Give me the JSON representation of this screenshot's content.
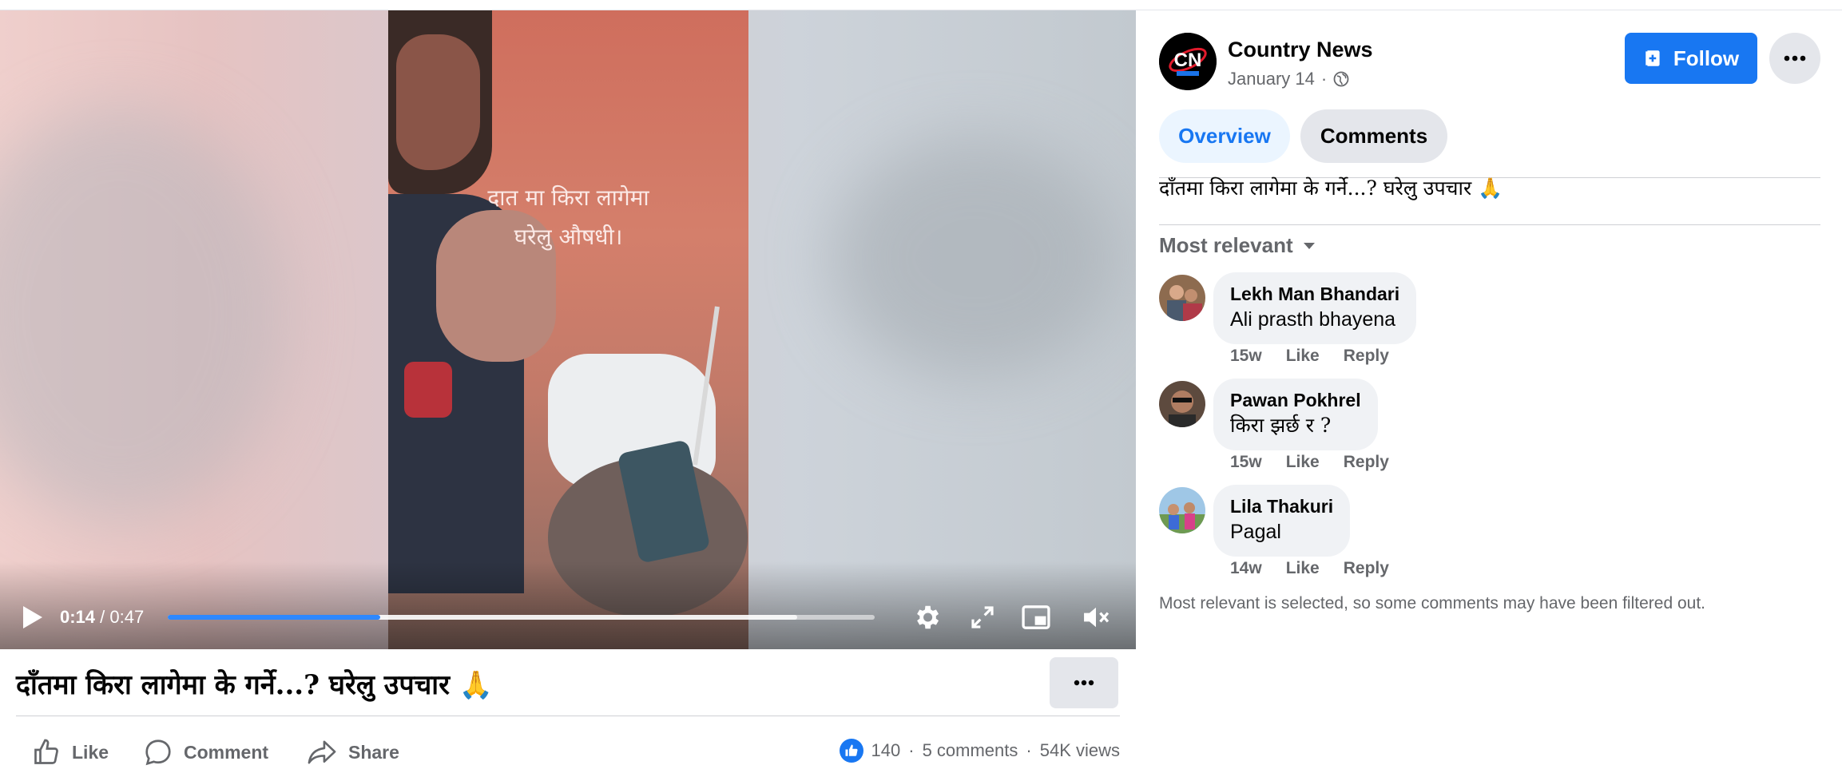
{
  "video": {
    "overlay_line1": "दात मा किरा लागेमा",
    "overlay_line2": "घरेलु औषधी।",
    "current_time": "0:14",
    "separator": "/",
    "duration": "0:47",
    "progress_fraction": 0.3,
    "buffered_fraction": 0.89
  },
  "post": {
    "title": "दाँतमा किरा लागेमा के गर्ने...? घरेलु उपचार 🙏",
    "actions": {
      "like": "Like",
      "comment": "Comment",
      "share": "Share"
    },
    "stats": {
      "reactions": "140",
      "dot1": "·",
      "comments": "5 comments",
      "dot2": "·",
      "views": "54K views"
    }
  },
  "page": {
    "name": "Country News",
    "date": "January 14",
    "meta_dot": "·",
    "avatar_text": "CN",
    "follow_label": "Follow"
  },
  "tabs": {
    "overview": "Overview",
    "comments": "Comments"
  },
  "caption": "दाँतमा किरा लागेमा के गर्ने...? घरेलु उपचार 🙏",
  "sort": {
    "label": "Most relevant"
  },
  "comments": [
    {
      "name": "Lekh Man Bhandari",
      "text": "Ali prasth bhayena",
      "time": "15w",
      "like": "Like",
      "reply": "Reply"
    },
    {
      "name": "Pawan Pokhrel",
      "text": "किरा झर्छ र ?",
      "time": "15w",
      "like": "Like",
      "reply": "Reply"
    },
    {
      "name": "Lila Thakuri",
      "text": "Pagal",
      "time": "14w",
      "like": "Like",
      "reply": "Reply"
    }
  ],
  "filter_note": "Most relevant is selected, so some comments may have been filtered out.",
  "colors": {
    "accent": "#1877f2",
    "progress": "#2d88ff",
    "muted_text": "#65676b",
    "bubble": "#f0f2f5"
  }
}
